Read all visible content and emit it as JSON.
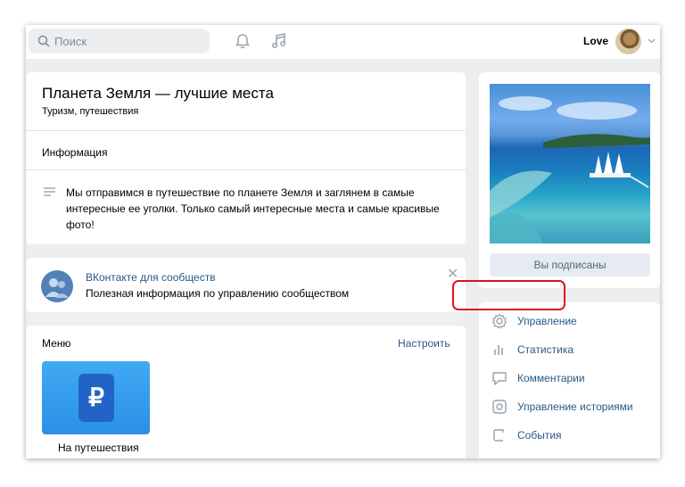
{
  "topbar": {
    "search_placeholder": "Поиск",
    "user_name": "Love"
  },
  "group": {
    "title": "Планета Земля — лучшие места",
    "subtitle": "Туризм, путешествия",
    "info_label": "Информация",
    "description": "Мы отправимся в путешествие по планете Земля и заглянем в самые интересные ее уголки. Только самый интересные места и самые красивые фото!"
  },
  "promo": {
    "title": "ВКонтакте для сообществ",
    "text": "Полезная информация по управлению сообществом",
    "close": "✕"
  },
  "menu": {
    "label": "Меню",
    "configure": "Настроить",
    "tile_symbol": "₽",
    "tile_label": "На путешествия"
  },
  "sidebar": {
    "subscribe_button": "Вы подписаны",
    "admin_items": [
      {
        "label": "Управление",
        "icon": "gear-icon"
      },
      {
        "label": "Статистика",
        "icon": "stats-icon"
      },
      {
        "label": "Комментарии",
        "icon": "comment-icon"
      },
      {
        "label": "Управление историями",
        "icon": "stories-icon"
      },
      {
        "label": "События",
        "icon": "events-icon"
      }
    ]
  },
  "colors": {
    "accent": "#2a5885",
    "highlight": "#e0111a",
    "background": "#edeef0"
  }
}
